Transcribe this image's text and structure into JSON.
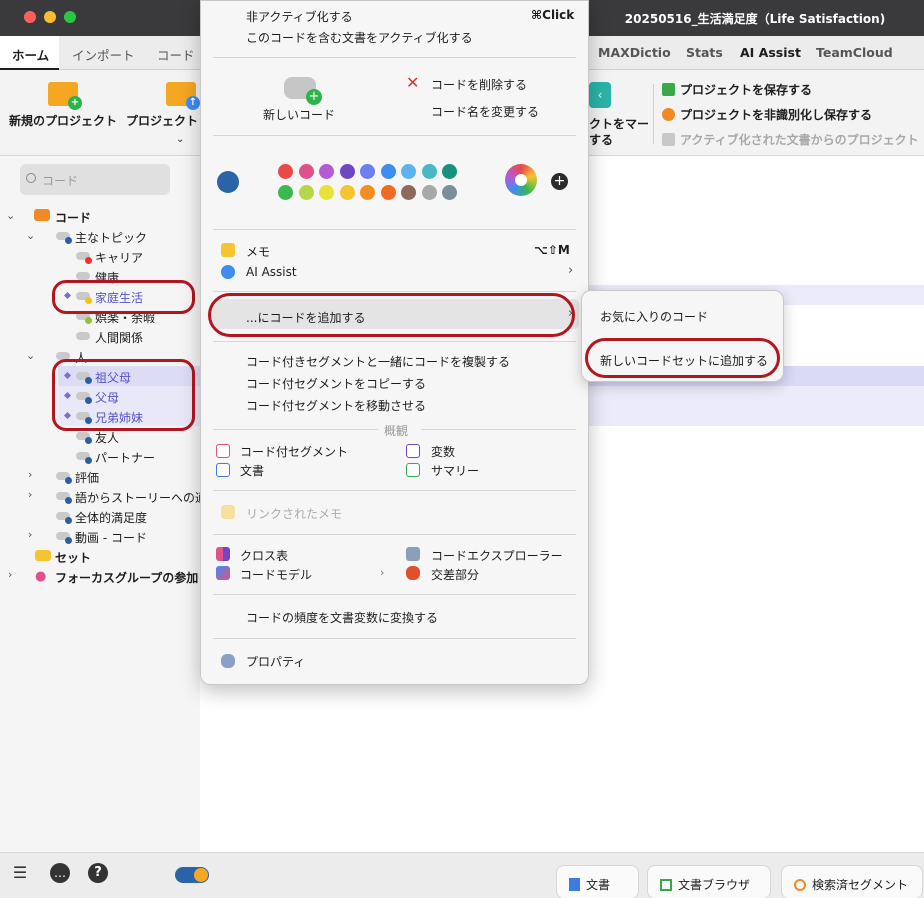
{
  "window": {
    "title": "20250516_生活満足度（Life Satisfaction)"
  },
  "tabs": [
    "ホーム",
    "インポート",
    "コード",
    "MAXDictio",
    "Stats",
    "AI Assist",
    "TeamCloud"
  ],
  "ribbon": {
    "new_project": "新規のプロジェクト",
    "project": "プロジェクト",
    "mark_project_line1": "クトをマー",
    "mark_project_line2": "する",
    "save_project": "プロジェクトを保存する",
    "anonymize_save": "プロジェクトを非識別化し保存する",
    "from_activated": "アクティブ化された文書からのプロジェクト"
  },
  "sidebar": {
    "search_placeholder": "コード",
    "root": "コード",
    "main_topics": "主なトピック",
    "career": "キャリア",
    "health": "健康",
    "family_life": "家庭生活",
    "leisure": "娯楽・余暇",
    "relationships": "人間関係",
    "people": "人",
    "grandparents": "祖父母",
    "parents": "父母",
    "siblings": "兄弟姉妹",
    "friends": "友人",
    "partner": "パートナー",
    "evaluation": "評価",
    "story": "語からストーリーへの適",
    "overall": "全体的満足度",
    "video": "動画 - コード",
    "sets": "セット",
    "focus": "フォーカスグループの参加"
  },
  "menu": {
    "deactivate": "非アクティブ化する",
    "deactivate_shortcut": "⌘Click",
    "activate_docs": "このコードを含む文書をアクティブ化する",
    "new_code": "新しいコード",
    "delete_code": "コードを削除する",
    "rename_code": "コード名を変更する",
    "memo": "メモ",
    "memo_shortcut": "⌥⇧M",
    "ai_assist": "AI Assist",
    "add_code_to": "...にコードを追加する",
    "duplicate": "コード付きセグメントと一緒にコードを複製する",
    "copy_segments": "コード付セグメントをコピーする",
    "move_segments": "コード付セグメントを移動させる",
    "overview": "概観",
    "coded_segments": "コード付セグメント",
    "variables": "変数",
    "documents": "文書",
    "summary": "サマリー",
    "linked_memos": "リンクされたメモ",
    "crosstab": "クロス表",
    "code_explorer": "コードエクスプローラー",
    "code_model": "コードモデル",
    "intersection": "交差部分",
    "convert_frequency": "コードの頻度を文書変数に変換する",
    "properties": "プロパティ",
    "colors_row1": [
      "#e84a4a",
      "#e0508a",
      "#b55ad6",
      "#6e48c4",
      "#6d7ef0",
      "#3d8ef0",
      "#5db3ef",
      "#4ab8c4",
      "#18927a"
    ],
    "colors_row2": [
      "#3cb850",
      "#b6d64a",
      "#e6e23a",
      "#f5c430",
      "#f58e20",
      "#f06a24",
      "#8e6a5a",
      "#a8a8a8",
      "#7a8f9a"
    ],
    "current_color": "#2a64a6"
  },
  "submenu": {
    "favorites": "お気に入りのコード",
    "add_to_new_set": "新しいコードセットに追加する"
  },
  "statusbar": {
    "documents": "文書",
    "doc_browser": "文書ブラウザ",
    "retrieved": "検索済セグメント"
  }
}
